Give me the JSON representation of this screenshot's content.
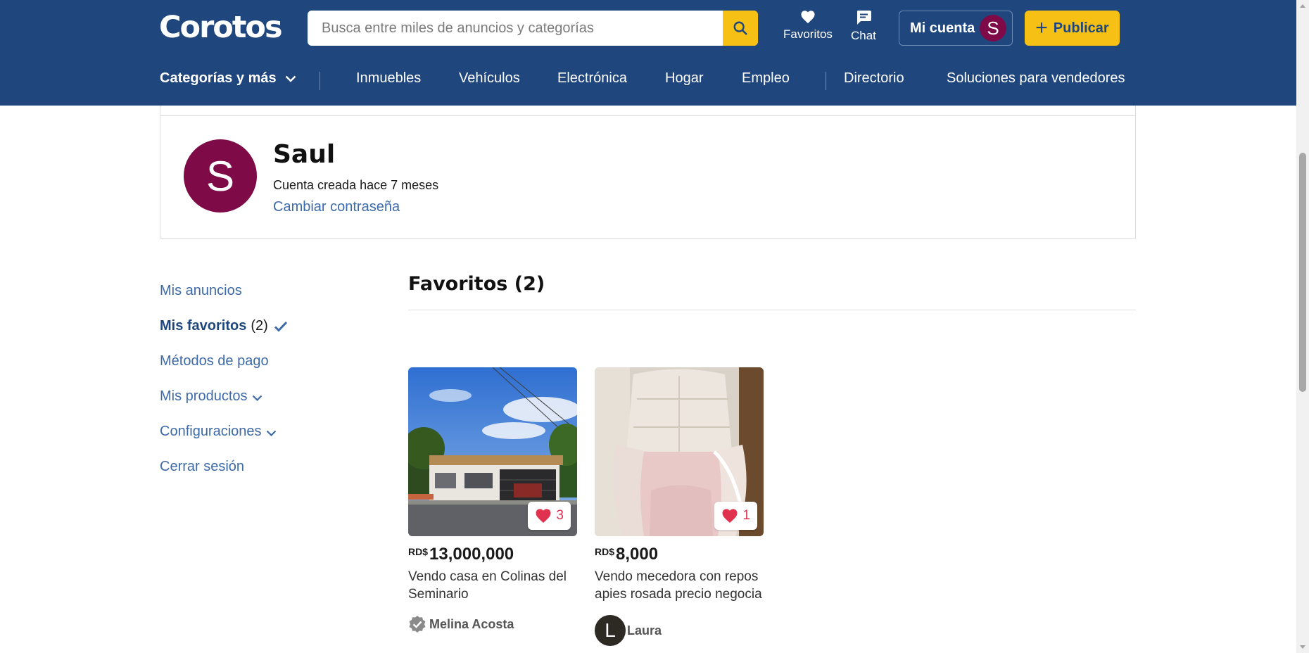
{
  "header": {
    "logo": "Corotos",
    "search_placeholder": "Busca entre miles de anuncios y categorías",
    "favorites_label": "Favoritos",
    "chat_label": "Chat",
    "account_label": "Mi cuenta",
    "account_initial": "S",
    "publish_label": "Publicar"
  },
  "nav": {
    "categories_label": "Categorías y más",
    "items": [
      "Inmuebles",
      "Vehículos",
      "Electrónica",
      "Hogar",
      "Empleo"
    ],
    "directory_label": "Directorio",
    "sellers_label": "Soluciones para vendedores"
  },
  "profile": {
    "initial": "S",
    "name": "Saul",
    "since": "Cuenta creada hace 7 meses",
    "change_password": "Cambiar contraseña"
  },
  "sidebar": {
    "items": [
      {
        "label": "Mis anuncios"
      },
      {
        "label": "Mis favoritos",
        "count": "(2)"
      },
      {
        "label": "Métodos de pago"
      },
      {
        "label": "Mis productos"
      },
      {
        "label": "Configuraciones"
      },
      {
        "label": "Cerrar sesión"
      }
    ]
  },
  "favorites": {
    "title": "Favoritos (2)",
    "items": [
      {
        "likes": "3",
        "currency": "RD$",
        "price": "13,000,000",
        "title": "Vendo casa en Colinas del Seminario",
        "seller": "Melina Acosta"
      },
      {
        "likes": "1",
        "currency": "RD$",
        "price": "8,000",
        "title": "Vendo mecedora con reposapies rosada precio negociable",
        "seller_initial": "L",
        "seller": "Laura"
      }
    ]
  },
  "colors": {
    "header_bg": "#1f477e",
    "accent_yellow": "#f6c014",
    "link_blue": "#3d6aa8",
    "avatar_maroon": "#7e0b47",
    "heart_red": "#e0324f"
  }
}
